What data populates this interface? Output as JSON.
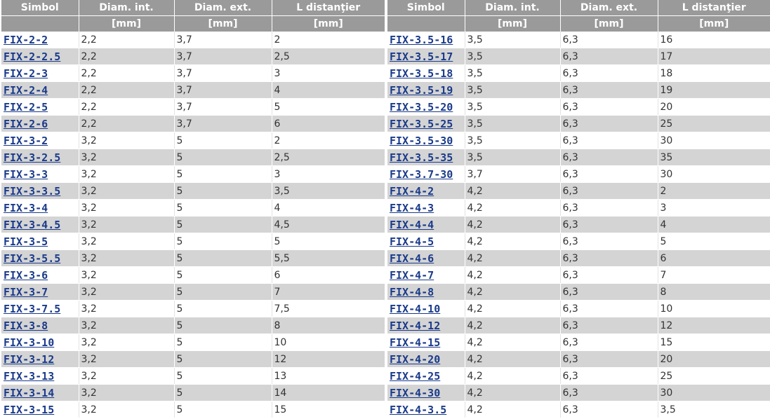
{
  "colors": {
    "header_bg": "#9a9a9a",
    "header_text": "#ffffff",
    "row_alt_bg": "#d4d4d4",
    "row_bg": "#ffffff",
    "link": "#1a3a8a",
    "cell_text": "#333333"
  },
  "headers": {
    "simbol": "Simbol",
    "diam_int": "Diam. int.",
    "diam_ext": "Diam. ext.",
    "l_dist": "L distanţier",
    "unit": "[mm]"
  },
  "left_rows": [
    {
      "symbol": "FIX-2-2",
      "d_int": "2,2",
      "d_ext": "3,7",
      "l": "2"
    },
    {
      "symbol": "FIX-2-2.5",
      "d_int": "2,2",
      "d_ext": "3,7",
      "l": "2,5"
    },
    {
      "symbol": "FIX-2-3",
      "d_int": "2,2",
      "d_ext": "3,7",
      "l": "3"
    },
    {
      "symbol": "FIX-2-4",
      "d_int": "2,2",
      "d_ext": "3,7",
      "l": "4"
    },
    {
      "symbol": "FIX-2-5",
      "d_int": "2,2",
      "d_ext": "3,7",
      "l": "5"
    },
    {
      "symbol": "FIX-2-6",
      "d_int": "2,2",
      "d_ext": "3,7",
      "l": "6"
    },
    {
      "symbol": "FIX-3-2",
      "d_int": "3,2",
      "d_ext": "5",
      "l": "2"
    },
    {
      "symbol": "FIX-3-2.5",
      "d_int": "3,2",
      "d_ext": "5",
      "l": "2,5"
    },
    {
      "symbol": "FIX-3-3",
      "d_int": "3,2",
      "d_ext": "5",
      "l": "3"
    },
    {
      "symbol": "FIX-3-3.5",
      "d_int": "3,2",
      "d_ext": "5",
      "l": "3,5"
    },
    {
      "symbol": "FIX-3-4",
      "d_int": "3,2",
      "d_ext": "5",
      "l": "4"
    },
    {
      "symbol": "FIX-3-4.5",
      "d_int": "3,2",
      "d_ext": "5",
      "l": "4,5"
    },
    {
      "symbol": "FIX-3-5",
      "d_int": "3,2",
      "d_ext": "5",
      "l": "5"
    },
    {
      "symbol": "FIX-3-5.5",
      "d_int": "3,2",
      "d_ext": "5",
      "l": "5,5"
    },
    {
      "symbol": "FIX-3-6",
      "d_int": "3,2",
      "d_ext": "5",
      "l": "6"
    },
    {
      "symbol": "FIX-3-7",
      "d_int": "3,2",
      "d_ext": "5",
      "l": "7"
    },
    {
      "symbol": "FIX-3-7.5",
      "d_int": "3,2",
      "d_ext": "5",
      "l": "7,5"
    },
    {
      "symbol": "FIX-3-8",
      "d_int": "3,2",
      "d_ext": "5",
      "l": "8"
    },
    {
      "symbol": "FIX-3-10",
      "d_int": "3,2",
      "d_ext": "5",
      "l": "10"
    },
    {
      "symbol": "FIX-3-12",
      "d_int": "3,2",
      "d_ext": "5",
      "l": "12"
    },
    {
      "symbol": "FIX-3-13",
      "d_int": "3,2",
      "d_ext": "5",
      "l": "13"
    },
    {
      "symbol": "FIX-3-14",
      "d_int": "3,2",
      "d_ext": "5",
      "l": "14"
    },
    {
      "symbol": "FIX-3-15",
      "d_int": "3,2",
      "d_ext": "5",
      "l": "15"
    }
  ],
  "right_rows": [
    {
      "symbol": "FIX-3.5-16",
      "d_int": "3,5",
      "d_ext": "6,3",
      "l": "16"
    },
    {
      "symbol": "FIX-3.5-17",
      "d_int": "3,5",
      "d_ext": "6,3",
      "l": "17"
    },
    {
      "symbol": "FIX-3.5-18",
      "d_int": "3,5",
      "d_ext": "6,3",
      "l": "18"
    },
    {
      "symbol": "FIX-3.5-19",
      "d_int": "3,5",
      "d_ext": "6,3",
      "l": "19"
    },
    {
      "symbol": "FIX-3.5-20",
      "d_int": "3,5",
      "d_ext": "6,3",
      "l": "20"
    },
    {
      "symbol": "FIX-3.5-25",
      "d_int": "3,5",
      "d_ext": "6,3",
      "l": "25"
    },
    {
      "symbol": "FIX-3.5-30",
      "d_int": "3,5",
      "d_ext": "6,3",
      "l": "30"
    },
    {
      "symbol": "FIX-3.5-35",
      "d_int": "3,5",
      "d_ext": "6,3",
      "l": "35"
    },
    {
      "symbol": "FIX-3.7-30",
      "d_int": "3,7",
      "d_ext": "6,3",
      "l": "30"
    },
    {
      "symbol": "FIX-4-2",
      "d_int": "4,2",
      "d_ext": "6,3",
      "l": "2"
    },
    {
      "symbol": "FIX-4-3",
      "d_int": "4,2",
      "d_ext": "6,3",
      "l": "3"
    },
    {
      "symbol": "FIX-4-4",
      "d_int": "4,2",
      "d_ext": "6,3",
      "l": "4"
    },
    {
      "symbol": "FIX-4-5",
      "d_int": "4,2",
      "d_ext": "6,3",
      "l": "5"
    },
    {
      "symbol": "FIX-4-6",
      "d_int": "4,2",
      "d_ext": "6,3",
      "l": "6"
    },
    {
      "symbol": "FIX-4-7",
      "d_int": "4,2",
      "d_ext": "6,3",
      "l": "7"
    },
    {
      "symbol": "FIX-4-8",
      "d_int": "4,2",
      "d_ext": "6,3",
      "l": "8"
    },
    {
      "symbol": "FIX-4-10",
      "d_int": "4,2",
      "d_ext": "6,3",
      "l": "10"
    },
    {
      "symbol": "FIX-4-12",
      "d_int": "4,2",
      "d_ext": "6,3",
      "l": "12"
    },
    {
      "symbol": "FIX-4-15",
      "d_int": "4,2",
      "d_ext": "6,3",
      "l": "15"
    },
    {
      "symbol": "FIX-4-20",
      "d_int": "4,2",
      "d_ext": "6,3",
      "l": "20"
    },
    {
      "symbol": "FIX-4-25",
      "d_int": "4,2",
      "d_ext": "6,3",
      "l": "25"
    },
    {
      "symbol": "FIX-4-30",
      "d_int": "4,2",
      "d_ext": "6,3",
      "l": "30"
    },
    {
      "symbol": "FIX-4-3.5",
      "d_int": "4,2",
      "d_ext": "6,3",
      "l": "3,5"
    }
  ]
}
